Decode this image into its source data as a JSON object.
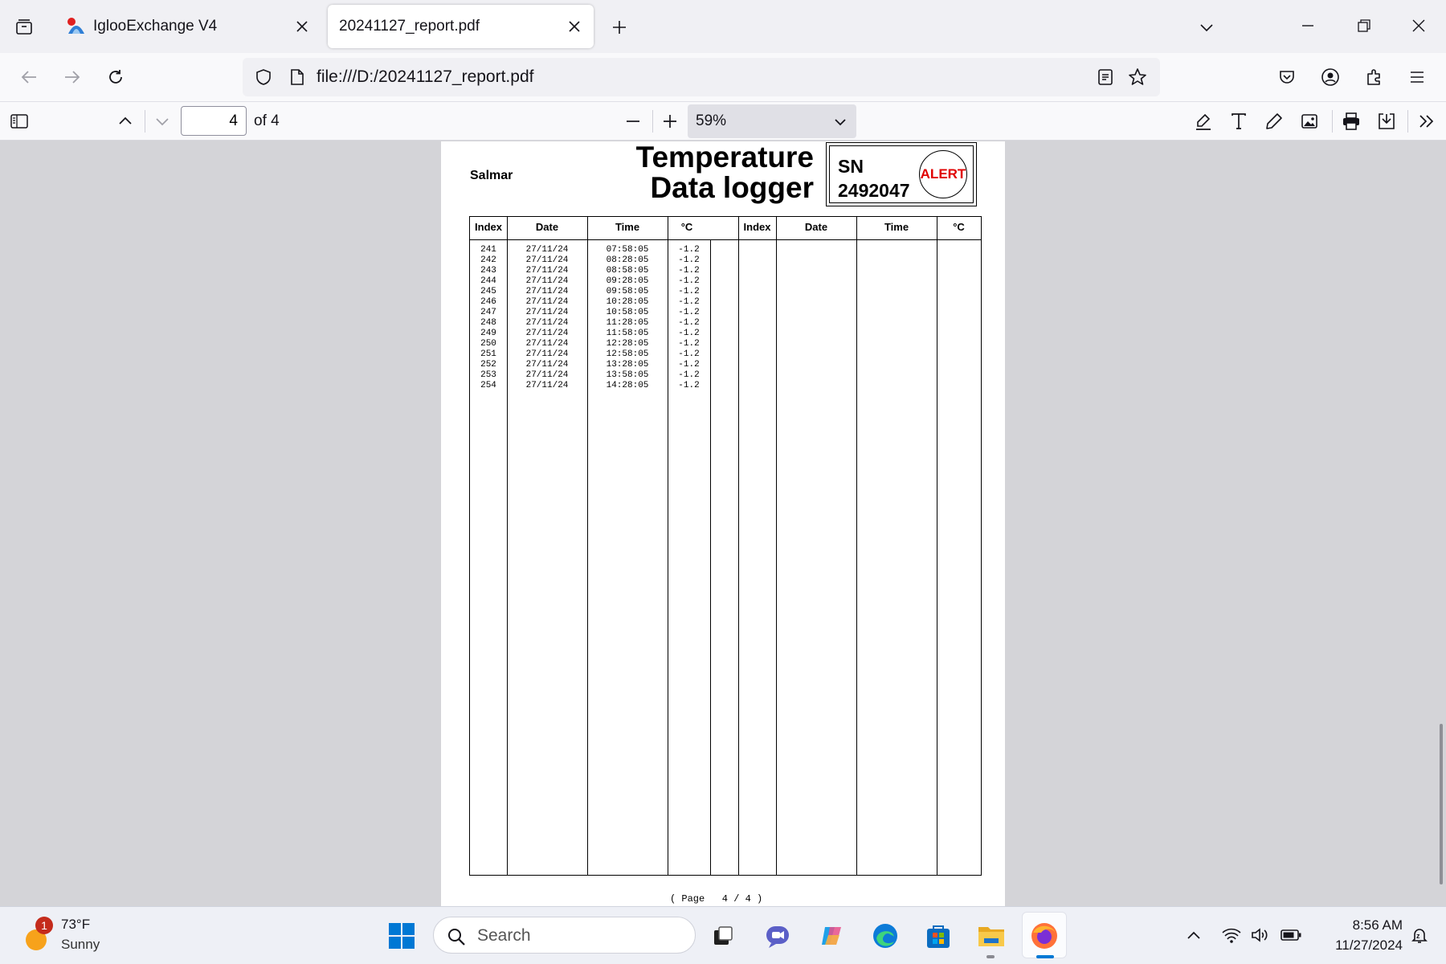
{
  "browser": {
    "tabs": [
      {
        "title": "IglooExchange V4",
        "active": false
      },
      {
        "title": "20241127_report.pdf",
        "active": true
      }
    ],
    "url": "file:///D:/20241127_report.pdf"
  },
  "pdf_toolbar": {
    "page_number": "4",
    "page_of": "of 4",
    "zoom": "59%"
  },
  "document": {
    "company": "Salmar",
    "title_line1": "Temperature",
    "title_line2": "Data logger",
    "sn_label": "SN",
    "sn_value": "2492047",
    "alert_label": "ALERT",
    "table": {
      "headers": [
        "Index",
        "Date",
        "Time",
        "°C",
        "Index",
        "Date",
        "Time",
        "°C"
      ],
      "rows": [
        [
          "241",
          "27/11/24",
          "07:58:05",
          "-1.2"
        ],
        [
          "242",
          "27/11/24",
          "08:28:05",
          "-1.2"
        ],
        [
          "243",
          "27/11/24",
          "08:58:05",
          "-1.2"
        ],
        [
          "244",
          "27/11/24",
          "09:28:05",
          "-1.2"
        ],
        [
          "245",
          "27/11/24",
          "09:58:05",
          "-1.2"
        ],
        [
          "246",
          "27/11/24",
          "10:28:05",
          "-1.2"
        ],
        [
          "247",
          "27/11/24",
          "10:58:05",
          "-1.2"
        ],
        [
          "248",
          "27/11/24",
          "11:28:05",
          "-1.2"
        ],
        [
          "249",
          "27/11/24",
          "11:58:05",
          "-1.2"
        ],
        [
          "250",
          "27/11/24",
          "12:28:05",
          "-1.2"
        ],
        [
          "251",
          "27/11/24",
          "12:58:05",
          "-1.2"
        ],
        [
          "252",
          "27/11/24",
          "13:28:05",
          "-1.2"
        ],
        [
          "253",
          "27/11/24",
          "13:58:05",
          "-1.2"
        ],
        [
          "254",
          "27/11/24",
          "14:28:05",
          "-1.2"
        ]
      ]
    },
    "footer": "( Page   4 / 4 )"
  },
  "taskbar": {
    "weather_temp": "73°F",
    "weather_condition": "Sunny",
    "weather_badge": "1",
    "search_placeholder": "Search",
    "time": "8:56 AM",
    "date": "11/27/2024"
  },
  "colors": {
    "alert_red": "#e00000",
    "accent_blue": "#0078d4",
    "firefox_orange": "#ff7139"
  }
}
